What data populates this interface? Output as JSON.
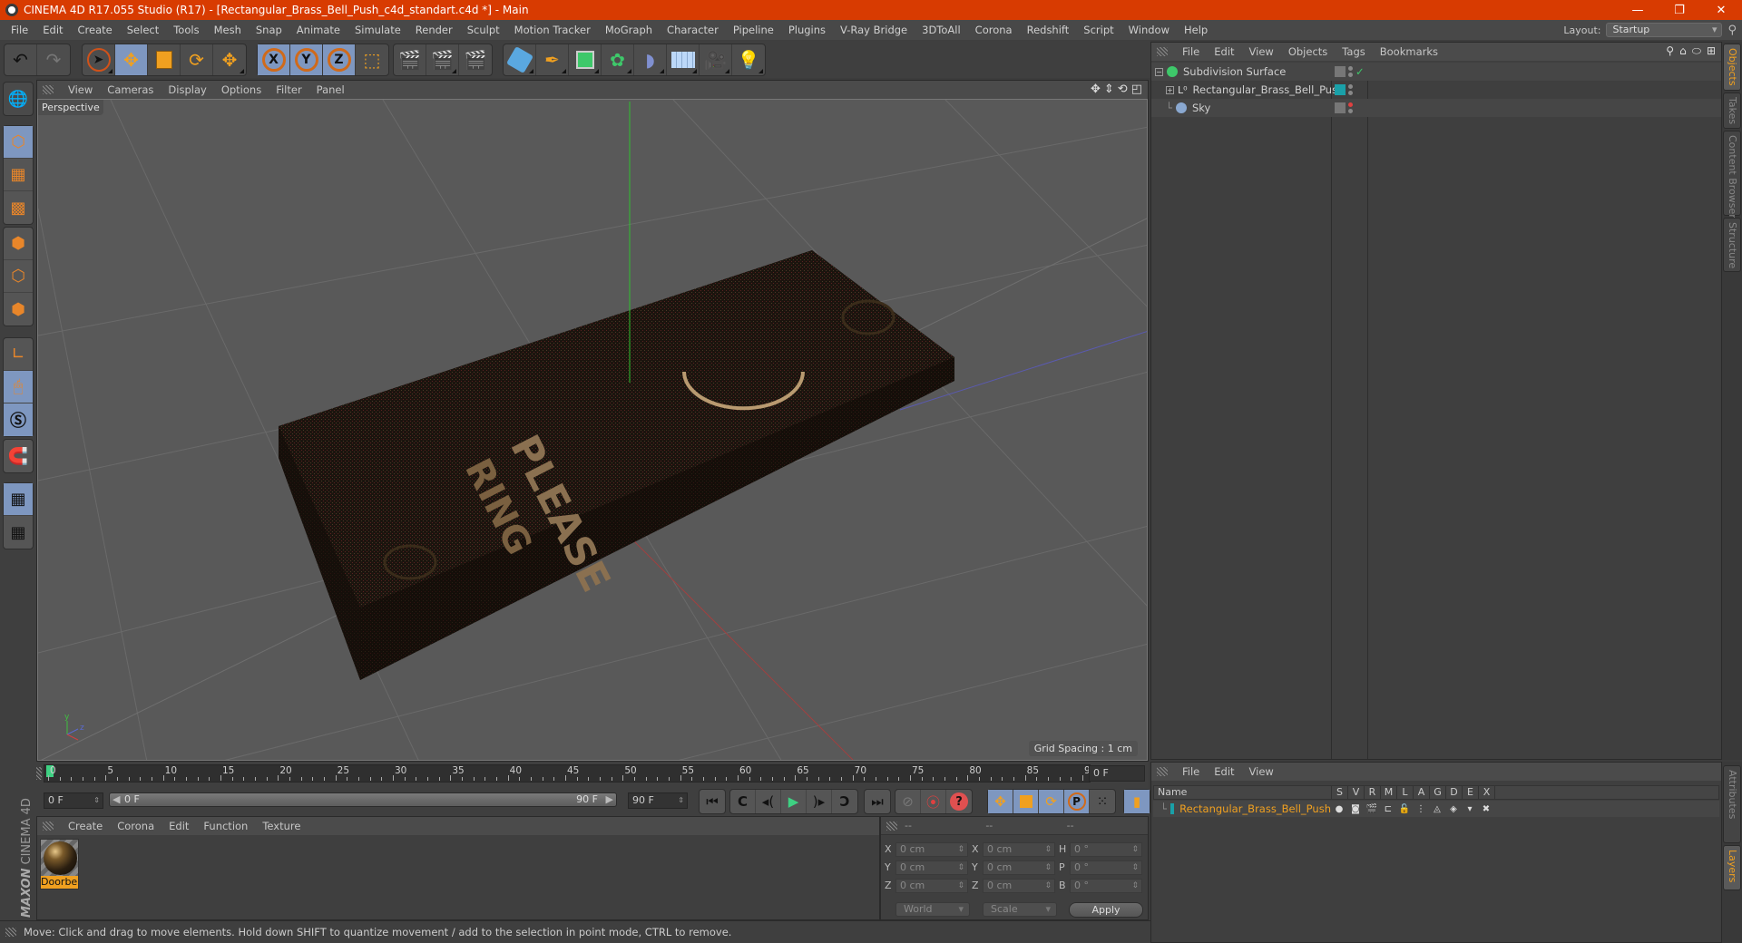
{
  "window": {
    "title": "CINEMA 4D R17.055 Studio (R17) - [Rectangular_Brass_Bell_Push_c4d_standart.c4d *] - Main",
    "controls": [
      "minimize",
      "restore",
      "close"
    ]
  },
  "menubar": {
    "items": [
      "File",
      "Edit",
      "Create",
      "Select",
      "Tools",
      "Mesh",
      "Snap",
      "Animate",
      "Simulate",
      "Render",
      "Sculpt",
      "Motion Tracker",
      "MoGraph",
      "Character",
      "Pipeline",
      "Plugins",
      "V-Ray Bridge",
      "3DToAll",
      "Corona",
      "Redshift",
      "Script",
      "Window",
      "Help"
    ],
    "layout_label": "Layout:",
    "layout_value": "Startup"
  },
  "toolbar": {
    "groups": [
      [
        "undo-icon",
        "redo-icon"
      ],
      [
        "live-selection-icon",
        "move-icon",
        "scale-icon",
        "rotate-icon",
        "move-tool-icon"
      ],
      [
        "x-axis-lock-icon",
        "y-axis-lock-icon",
        "z-axis-lock-icon",
        "world-coordinates-icon"
      ],
      [
        "render-view-icon",
        "render-picture-viewer-icon",
        "render-settings-icon"
      ],
      [
        "cube-icon",
        "pen-spline-icon",
        "subdivision-icon",
        "mograph-cloner-icon",
        "deformer-icon",
        "floor-icon",
        "camera-icon",
        "light-icon"
      ]
    ],
    "axis_labels": [
      "X",
      "Y",
      "Z"
    ]
  },
  "left_tools": [
    "model-mode-icon",
    "object-mode-icon",
    "texture-mode-icon",
    "workplane-mode-icon",
    "points-mode-icon",
    "edges-mode-icon",
    "polygons-mode-icon",
    "axis-mode-icon",
    "tweak-mode-icon",
    "solo-mode-icon",
    "snap-icon",
    "workplane-lock-icon",
    "workplane-align-icon"
  ],
  "viewport": {
    "menu": [
      "View",
      "Cameras",
      "Display",
      "Options",
      "Filter",
      "Panel"
    ],
    "label": "Perspective",
    "grid_spacing": "Grid Spacing : 1 cm",
    "model_text": [
      "PLEASE",
      "RING"
    ]
  },
  "timeline": {
    "ticks": [
      0,
      5,
      10,
      15,
      20,
      25,
      30,
      35,
      40,
      45,
      50,
      55,
      60,
      65,
      70,
      75,
      80,
      85,
      90
    ],
    "max_frame": 90,
    "current_frame": 0,
    "current_frame_label": "0 F",
    "start_field": "0 F",
    "range_start": "0 F",
    "range_end": "90 F",
    "end_field": "90 F"
  },
  "transport": {
    "buttons": [
      "go-to-start",
      "previous-key",
      "previous-frame",
      "play",
      "next-frame",
      "next-key",
      "go-to-end"
    ],
    "record_buttons": [
      "record-disabled",
      "autokey",
      "key-help"
    ],
    "key_buttons": [
      "move-key",
      "scale-key",
      "rotate-key",
      "param-key",
      "point-level-key"
    ],
    "param_label": "P"
  },
  "material_panel": {
    "menu": [
      "Create",
      "Corona",
      "Edit",
      "Function",
      "Texture"
    ],
    "materials": [
      {
        "name": "Doorbel"
      }
    ]
  },
  "brand": {
    "maxon": "MAXON",
    "product": "CINEMA 4D"
  },
  "coords": {
    "headers": [
      "--",
      "--",
      "--"
    ],
    "rows": [
      {
        "pos_label": "X",
        "pos": "0 cm",
        "size_label": "X",
        "size": "0 cm",
        "rot_label": "H",
        "rot": "0 °"
      },
      {
        "pos_label": "Y",
        "pos": "0 cm",
        "size_label": "Y",
        "size": "0 cm",
        "rot_label": "P",
        "rot": "0 °"
      },
      {
        "pos_label": "Z",
        "pos": "0 cm",
        "size_label": "Z",
        "size": "0 cm",
        "rot_label": "B",
        "rot": "0 °"
      }
    ],
    "space_dropdown": "World",
    "mode_dropdown": "Scale",
    "apply_label": "Apply"
  },
  "status": {
    "message": "Move: Click and drag to move elements. Hold down SHIFT to quantize movement / add to the selection in point mode, CTRL to remove."
  },
  "objects_panel": {
    "menu": [
      "File",
      "Edit",
      "View",
      "Objects",
      "Tags",
      "Bookmarks"
    ],
    "objects": [
      {
        "name": "Subdivision Surface",
        "icon": "subdivision-surface-icon",
        "color": "#3ec86a",
        "check": "✓"
      },
      {
        "name": "Rectangular_Brass_Bell_Push",
        "icon": "null-object-icon",
        "color": "#1aa0a8"
      },
      {
        "name": "Sky",
        "icon": "sky-icon",
        "color": "#8aa8d0"
      }
    ]
  },
  "right_tabs": [
    "Objects",
    "Takes",
    "Content Browser",
    "Structure"
  ],
  "layers_panel": {
    "menu": [
      "File",
      "Edit",
      "View"
    ],
    "columns": [
      "Name",
      "S",
      "V",
      "R",
      "M",
      "L",
      "A",
      "G",
      "D",
      "E",
      "X"
    ],
    "layers": [
      {
        "name": "Rectangular_Brass_Bell_Push",
        "color": "#1aa0a8"
      }
    ]
  },
  "lower_right_tabs": [
    "Attributes",
    "Layers"
  ],
  "colors": {
    "title_bar": "#d83b01",
    "accent": "#f0a020",
    "selection_blue": "#7e97c0"
  }
}
